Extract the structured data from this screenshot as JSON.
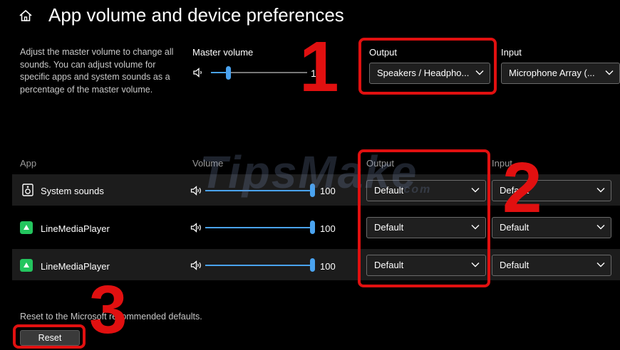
{
  "header": {
    "title": "App volume and device preferences",
    "home_icon": "home-icon"
  },
  "master": {
    "description": "Adjust the master volume to change all sounds. You can adjust volume for specific apps and system sounds as a percentage of the master volume.",
    "volume_label": "Master volume",
    "volume_value": "10",
    "volume_level": 0.1,
    "output_label": "Output",
    "output_value": "Speakers / Headpho...",
    "input_label": "Input",
    "input_value": "Microphone Array (..."
  },
  "table": {
    "headers": {
      "app": "App",
      "volume": "Volume",
      "output": "Output",
      "input": "Input"
    },
    "rows": [
      {
        "name": "System sounds",
        "icon": "system-sounds-icon",
        "volume": "100",
        "output": "Default",
        "input": "Default"
      },
      {
        "name": "LineMediaPlayer",
        "icon": "line-app-icon",
        "volume": "100",
        "output": "Default",
        "input": "Default"
      },
      {
        "name": "LineMediaPlayer",
        "icon": "line-app-icon",
        "volume": "100",
        "output": "Default",
        "input": "Default"
      }
    ]
  },
  "reset": {
    "text": "Reset to the Microsoft recommended defaults.",
    "button_label": "Reset"
  },
  "annotations": {
    "n1": "1",
    "n2": "2",
    "n3": "3",
    "watermark": "TipsMake",
    "watermark_suffix": ".com"
  },
  "colors": {
    "accent": "#4aa3f0",
    "annotation_red": "#e11010",
    "background": "#000000"
  }
}
